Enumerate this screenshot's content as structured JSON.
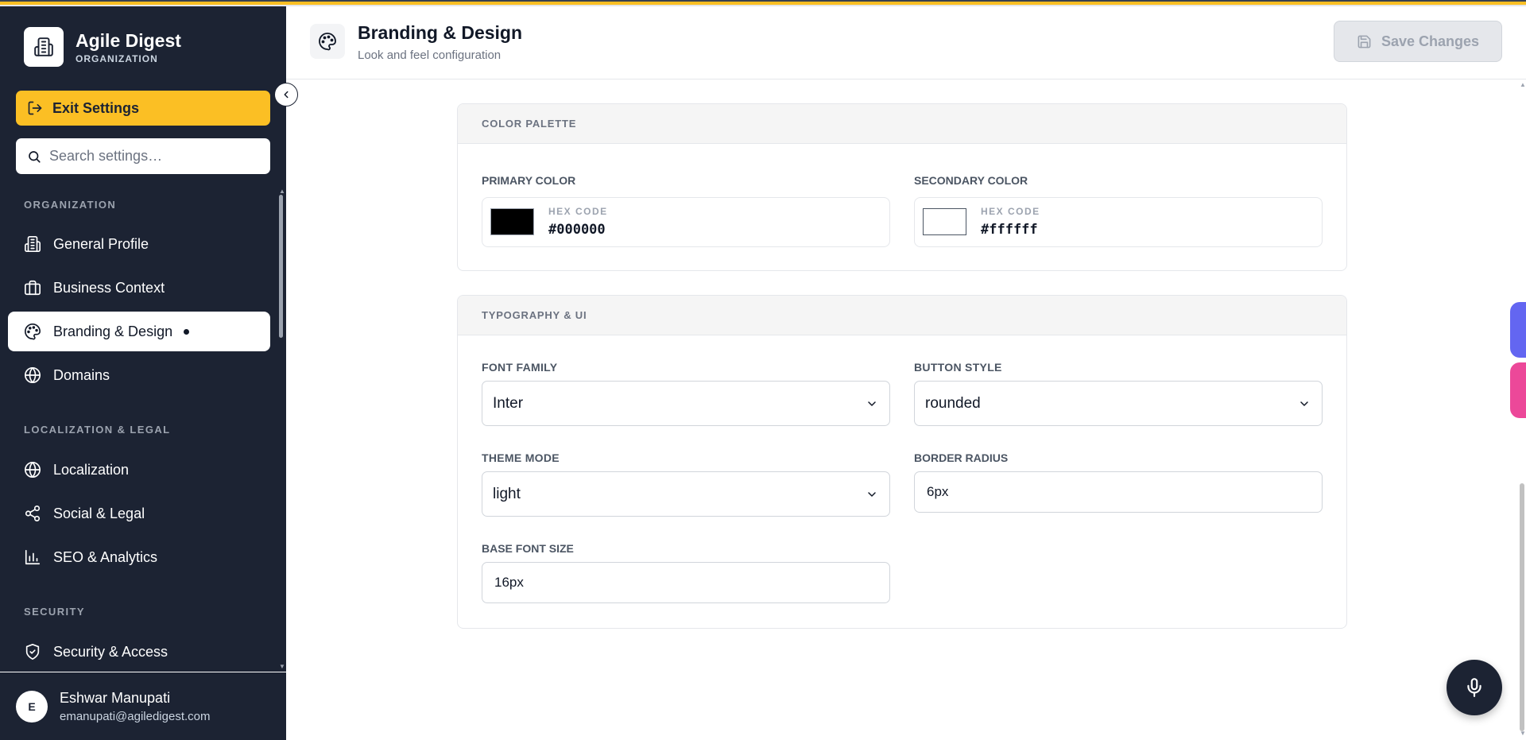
{
  "brand": {
    "title": "Agile Digest",
    "subtitle": "ORGANIZATION"
  },
  "sidebar": {
    "exit_label": "Exit Settings",
    "search_placeholder": "Search settings…",
    "sections": [
      {
        "title": "ORGANIZATION",
        "items": [
          {
            "label": "General Profile",
            "icon": "building-icon"
          },
          {
            "label": "Business Context",
            "icon": "briefcase-icon"
          },
          {
            "label": "Branding & Design",
            "icon": "palette-icon",
            "active": true,
            "unsaved_dot": true
          },
          {
            "label": "Domains",
            "icon": "globe-icon"
          }
        ]
      },
      {
        "title": "LOCALIZATION & LEGAL",
        "items": [
          {
            "label": "Localization",
            "icon": "globe-icon"
          },
          {
            "label": "Social & Legal",
            "icon": "share-icon"
          },
          {
            "label": "SEO & Analytics",
            "icon": "bar-chart-icon"
          }
        ]
      },
      {
        "title": "SECURITY",
        "items": [
          {
            "label": "Security & Access",
            "icon": "shield-icon"
          }
        ]
      }
    ]
  },
  "user": {
    "initial": "E",
    "name": "Eshwar Manupati",
    "email": "emanupati@agiledigest.com"
  },
  "header": {
    "title": "Branding & Design",
    "subtitle": "Look and feel configuration",
    "save_label": "Save Changes"
  },
  "color_palette": {
    "heading": "COLOR PALETTE",
    "primary": {
      "label": "PRIMARY COLOR",
      "hex_label": "HEX CODE",
      "value": "#000000"
    },
    "secondary": {
      "label": "SECONDARY COLOR",
      "hex_label": "HEX CODE",
      "value": "#ffffff"
    }
  },
  "typography": {
    "heading": "TYPOGRAPHY & UI",
    "font_family": {
      "label": "FONT FAMILY",
      "value": "Inter"
    },
    "button_style": {
      "label": "BUTTON STYLE",
      "value": "rounded"
    },
    "theme_mode": {
      "label": "THEME MODE",
      "value": "light"
    },
    "border_radius": {
      "label": "BORDER RADIUS",
      "value": "6px"
    },
    "base_font_size": {
      "label": "BASE FONT SIZE",
      "value": "16px"
    }
  },
  "colors": {
    "sidebar_bg": "#1c2333",
    "accent": "#fbbf24",
    "float_purple": "#6366f1",
    "float_pink": "#ec4899"
  }
}
